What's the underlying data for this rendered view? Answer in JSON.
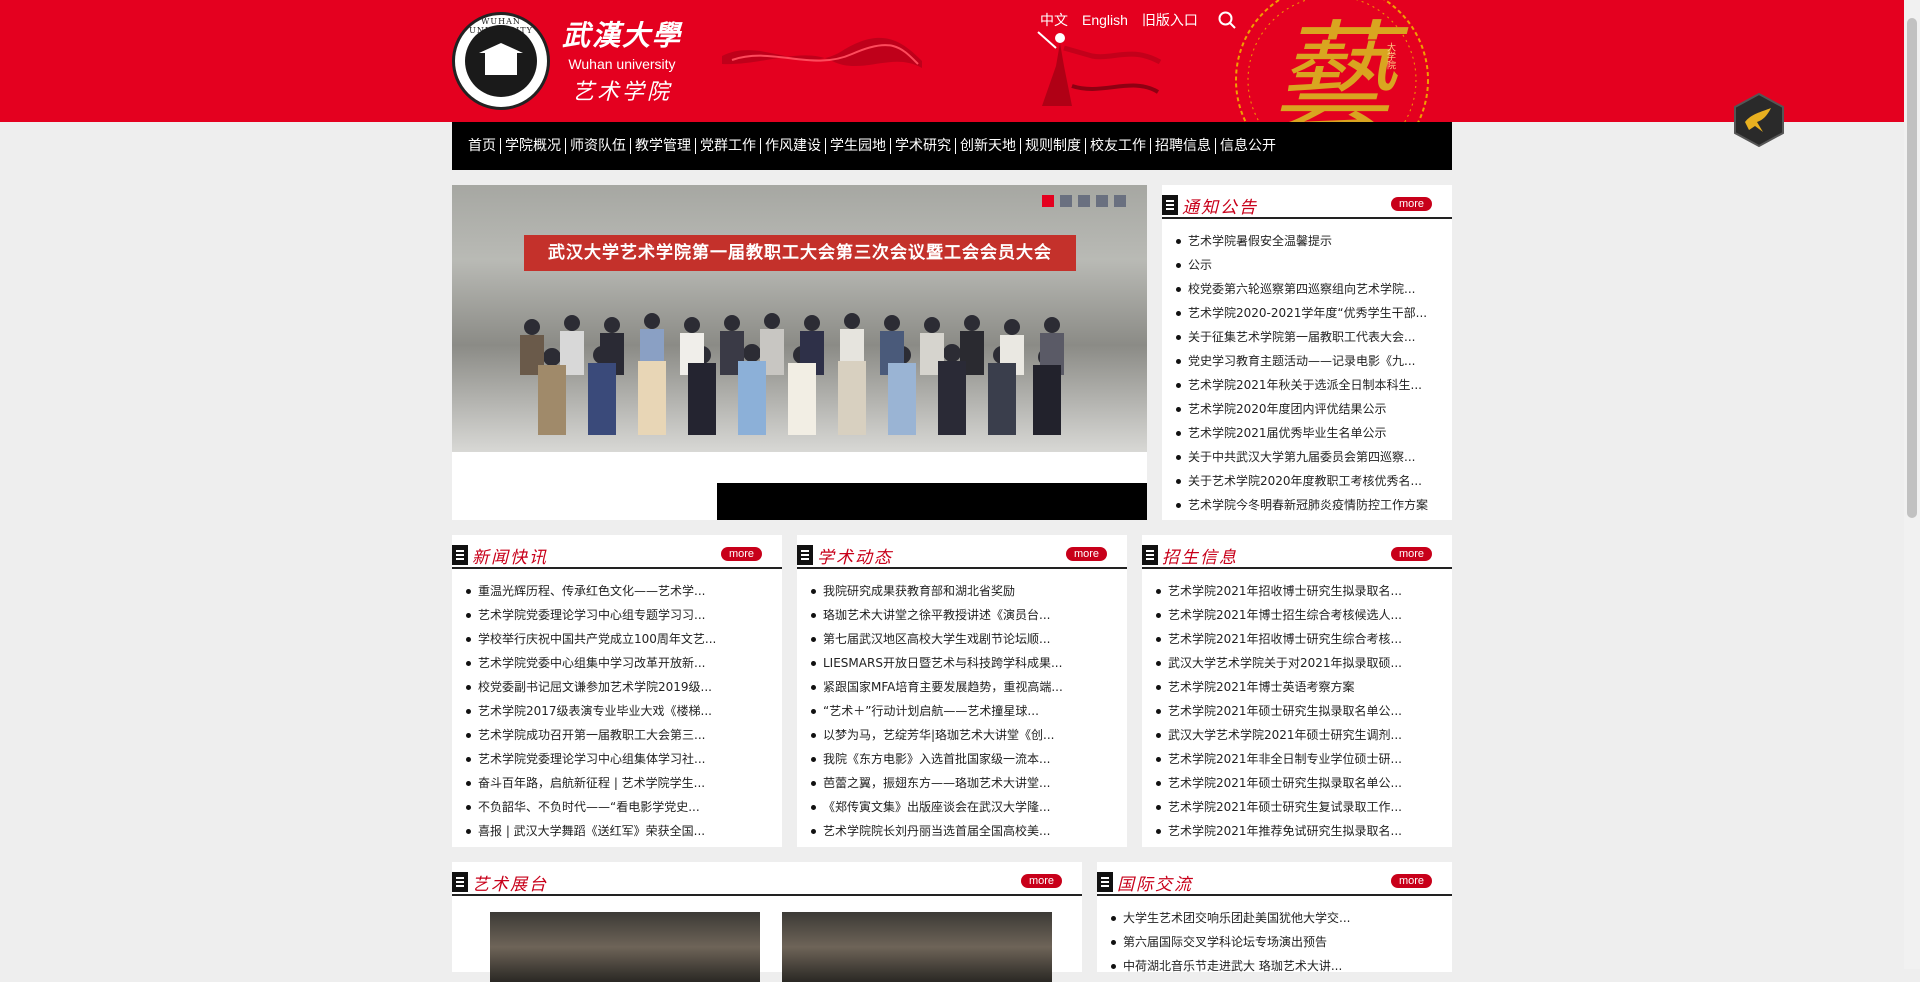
{
  "header": {
    "seal_text": "WUHAN UNIVERSITY",
    "brand_cn": "武漢大學",
    "brand_en": "Wuhan university",
    "brand_sub": "艺术学院",
    "links": [
      "中文",
      "English",
      "旧版入口"
    ],
    "search_icon": "search-icon",
    "seal_art_char": "藝",
    "seal_art_small": "大学院"
  },
  "nav": [
    "首页",
    "学院概况",
    "师资队伍",
    "教学管理",
    "党群工作",
    "作风建设",
    "学生园地",
    "学术研究",
    "创新天地",
    "规则制度",
    "校友工作",
    "招聘信息",
    "信息公开"
  ],
  "slider": {
    "banner_text": "武汉大学艺术学院第一届教职工大会第三次会议暨工会会员大会",
    "dot_count": 5,
    "active_dot": 0
  },
  "more_label": "more",
  "notice": {
    "title": "通知公告",
    "items": [
      "艺术学院暑假安全温馨提示",
      "公示",
      "校党委第六轮巡察第四巡察组向艺术学院...",
      "艺术学院2020-2021学年度“优秀学生干部...",
      "关于征集艺术学院第一届教职工代表大会...",
      "党史学习教育主题活动——记录电影《九...",
      "艺术学院2021年秋关于选派全日制本科生...",
      "艺术学院2020年度团内评优结果公示",
      "艺术学院2021届优秀毕业生名单公示",
      "关于中共武汉大学第九届委员会第四巡察...",
      "关于艺术学院2020年度教职工考核优秀名...",
      "艺术学院今冬明春新冠肺炎疫情防控工作方案"
    ]
  },
  "news": {
    "title": "新闻快讯",
    "items": [
      "重温光辉历程、传承红色文化——艺术学...",
      "艺术学院党委理论学习中心组专题学习习...",
      "学校举行庆祝中国共产党成立100周年文艺...",
      "艺术学院党委中心组集中学习改革开放新...",
      "校党委副书记屈文谦参加艺术学院2019级...",
      "艺术学院2017级表演专业毕业大戏《楼梯...",
      "艺术学院成功召开第一届教职工大会第三...",
      "艺术学院党委理论学习中心组集体学习社...",
      "奋斗百年路，启航新征程 | 艺术学院学生...",
      "不负韶华、不负时代——“看电影学党史...",
      "喜报 | 武汉大学舞蹈《送红军》荣获全国..."
    ]
  },
  "academic": {
    "title": "学术动态",
    "items": [
      "我院研究成果获教育部和湖北省奖励",
      "珞珈艺术大讲堂之徐平教授讲述《演员台...",
      "第七届武汉地区高校大学生戏剧节论坛顺...",
      "LIESMARS开放日暨艺术与科技跨学科成果...",
      "紧跟国家MFA培育主要发展趋势，重视高端...",
      "“艺术＋”行动计划启航——艺术撞星球...",
      "以梦为马，艺绽芳华|珞珈艺术大讲堂《创...",
      "我院《东方电影》入选首批国家级一流本...",
      "芭蕾之翼，振翅东方——珞珈艺术大讲堂...",
      "《郑传寅文集》出版座谈会在武汉大学隆...",
      "艺术学院院长刘丹丽当选首届全国高校美..."
    ]
  },
  "admission": {
    "title": "招生信息",
    "items": [
      "艺术学院2021年招收博士研究生拟录取名...",
      "艺术学院2021年博士招生综合考核候选人...",
      "艺术学院2021年招收博士研究生综合考核...",
      "武汉大学艺术学院关于对2021年拟录取硕...",
      "艺术学院2021年博士英语考察方案",
      "艺术学院2021年硕士研究生拟录取名单公...",
      "武汉大学艺术学院2021年硕士研究生调剂...",
      "艺术学院2021年非全日制专业学位硕士研...",
      "艺术学院2021年硕士研究生拟录取名单公...",
      "艺术学院2021年硕士研究生复试录取工作...",
      "艺术学院2021年推荐免试研究生拟录取名..."
    ]
  },
  "exhibit": {
    "title": "艺术展台"
  },
  "intl": {
    "title": "国际交流",
    "items": [
      "大学生艺术团交响乐团赴美国犹他大学交...",
      "第六届国际交叉学科论坛专场演出预告",
      "中荷湖北音乐节走进武大 珞珈艺术大讲..."
    ]
  },
  "colors": {
    "brand_red": "#e4001f",
    "nav_black": "#000000",
    "title_red": "#c8001a"
  }
}
